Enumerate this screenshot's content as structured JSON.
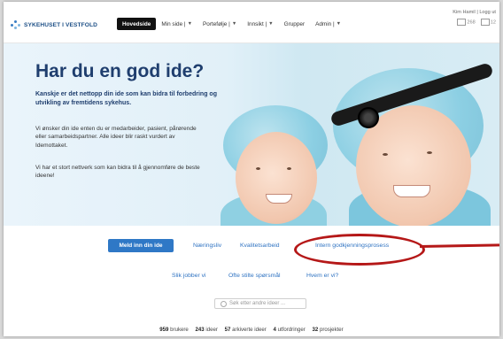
{
  "header": {
    "logo_text": "SYKEHUSET I VESTFOLD",
    "nav": [
      {
        "label": "Hovedside",
        "dropdown": false,
        "active": true
      },
      {
        "label": "Min side |",
        "dropdown": true,
        "active": false
      },
      {
        "label": "Portefølje |",
        "dropdown": true,
        "active": false
      },
      {
        "label": "Innsikt |",
        "dropdown": true,
        "active": false
      },
      {
        "label": "Grupper",
        "dropdown": false,
        "active": false
      },
      {
        "label": "Admin |",
        "dropdown": true,
        "active": false
      }
    ],
    "user_links": "Kim Hamil | Logg ut",
    "count_a": "268",
    "count_b": "12"
  },
  "hero": {
    "title": "Har du en god ide?",
    "lead": "Kanskje er det nettopp din ide som kan bidra til forbedring og utvikling av fremtidens sykehus.",
    "p1": "Vi ønsker din ide enten du er medarbeider, pasient, pårørende eller samarbeidspartner. Alle ideer blir raskt vurdert av Idemottaket.",
    "p2": "Vi har et stort nettverk som kan bidra til å gjennomføre de beste ideene!"
  },
  "actions": {
    "primary_button": "Meld inn din ide",
    "links_row1": [
      "Næringsliv",
      "Kvalitetsarbeid",
      "Intern godkjenningsprosess"
    ],
    "links_row2": [
      "Slik jobber vi",
      "Ofte stilte spørsmål",
      "Hvem er vi?"
    ],
    "search_placeholder": "Søk etter andre ideer ..."
  },
  "stats": [
    {
      "value": "959",
      "label": "brukere"
    },
    {
      "value": "243",
      "label": "ideer"
    },
    {
      "value": "57",
      "label": "arkiverte ideer"
    },
    {
      "value": "4",
      "label": "utfordringer"
    },
    {
      "value": "32",
      "label": "prosjekter"
    }
  ],
  "colors": {
    "accent": "#2f78c6",
    "title": "#1f3e6e",
    "annotation": "#b51818"
  }
}
